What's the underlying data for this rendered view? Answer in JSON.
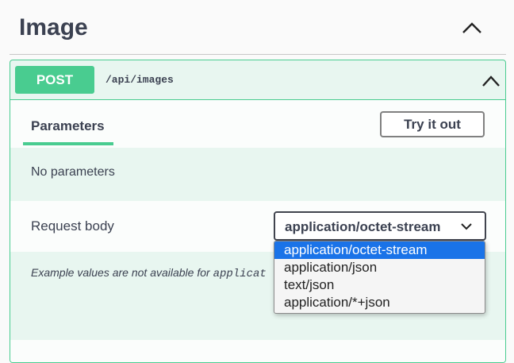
{
  "section": {
    "title": "Image",
    "toggle_icon": "chevron-up-icon"
  },
  "operation": {
    "method": "POST",
    "path": "/api/images",
    "method_color": "#49cc90",
    "toggle_icon": "chevron-up-icon"
  },
  "parameters": {
    "tab_label": "Parameters",
    "try_label": "Try it out",
    "empty_text": "No parameters"
  },
  "request_body": {
    "label": "Request body",
    "content_type": "application/octet-stream",
    "select_icon": "chevron-down-icon",
    "options": [
      "application/octet-stream",
      "application/json",
      "text/json",
      "application/*+json"
    ],
    "selected_index": 0,
    "example_text": "Example values are not available for ",
    "example_code": "applicat"
  }
}
